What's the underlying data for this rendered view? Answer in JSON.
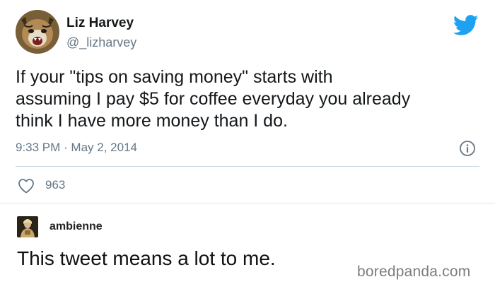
{
  "tweet": {
    "author_name": "Liz Harvey",
    "author_handle": "@_lizharvey",
    "avatar_icon": "cat-avatar",
    "platform_icon": "twitter-bird-icon",
    "brand_color": "#1da1f2",
    "text": "If your \"tips on saving money\" starts with\nassuming I pay $5 for coffee everyday you already\nthink I have more money than I do.",
    "timestamp": "9:33 PM · May 2, 2014",
    "likes": "963",
    "like_icon": "heart-outline-icon",
    "info_icon": "info-icon"
  },
  "reply": {
    "username": "ambienne",
    "avatar_icon": "painting-avatar",
    "text": "This tweet means a lot to me."
  },
  "watermark": {
    "text": "boredpanda.com"
  }
}
